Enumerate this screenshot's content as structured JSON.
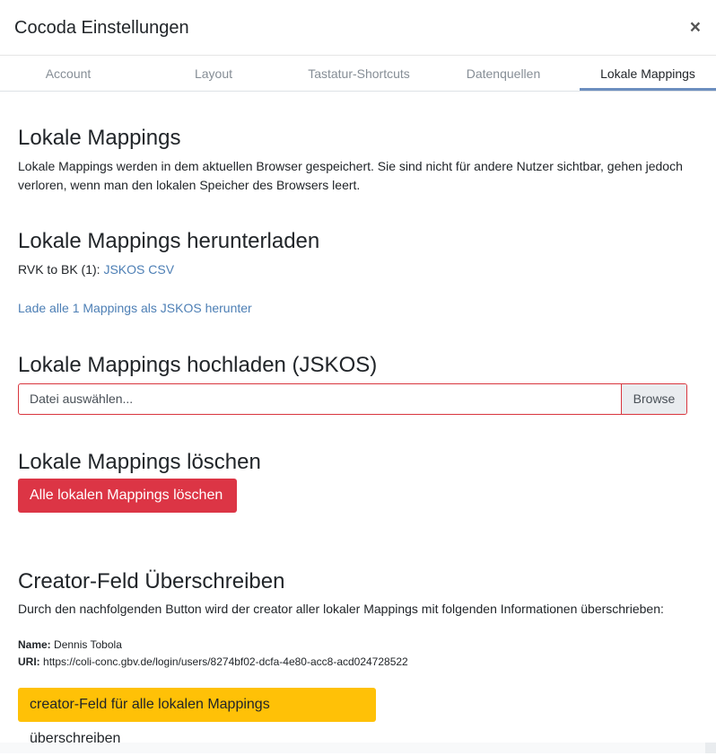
{
  "modal": {
    "title": "Cocoda Einstellungen",
    "close_label": "×"
  },
  "tabs": [
    {
      "label": "Account",
      "active": false
    },
    {
      "label": "Layout",
      "active": false
    },
    {
      "label": "Tastatur-Shortcuts",
      "active": false
    },
    {
      "label": "Datenquellen",
      "active": false
    },
    {
      "label": "Lokale Mappings",
      "active": true
    }
  ],
  "intro": {
    "heading": "Lokale Mappings",
    "text": "Lokale Mappings werden in dem aktuellen Browser gespeichert. Sie sind nicht für andere Nutzer sichtbar, gehen jedoch verloren, wenn man den lokalen Speicher des Browsers leert."
  },
  "download": {
    "heading": "Lokale Mappings herunterladen",
    "item_label": "RVK to BK (1):",
    "item_link": "JSKOS CSV",
    "all_link": "Lade alle 1 Mappings als JSKOS herunter"
  },
  "upload": {
    "heading": "Lokale Mappings hochladen (JSKOS)",
    "placeholder": "Datei auswählen...",
    "browse_label": "Browse"
  },
  "delete": {
    "heading": "Lokale Mappings löschen",
    "button_label": "Alle lokalen Mappings löschen"
  },
  "creator": {
    "heading": "Creator-Feld Überschreiben",
    "text": "Durch den nachfolgenden Button wird der creator aller lokaler Mappings mit folgenden Informationen überschrieben:",
    "name_label": "Name:",
    "name_value": "Dennis Tobola",
    "uri_label": "URI:",
    "uri_value": "https://coli-conc.gbv.de/login/users/8274bf02-dcfa-4e80-acc8-acd024728522",
    "button_label": "creator-Feld für alle lokalen Mappings überschreiben"
  },
  "colors": {
    "danger": "#dc3545",
    "warning": "#ffc107",
    "link": "#4d7fb5",
    "active_tab_underline": "#6c8ebf"
  }
}
